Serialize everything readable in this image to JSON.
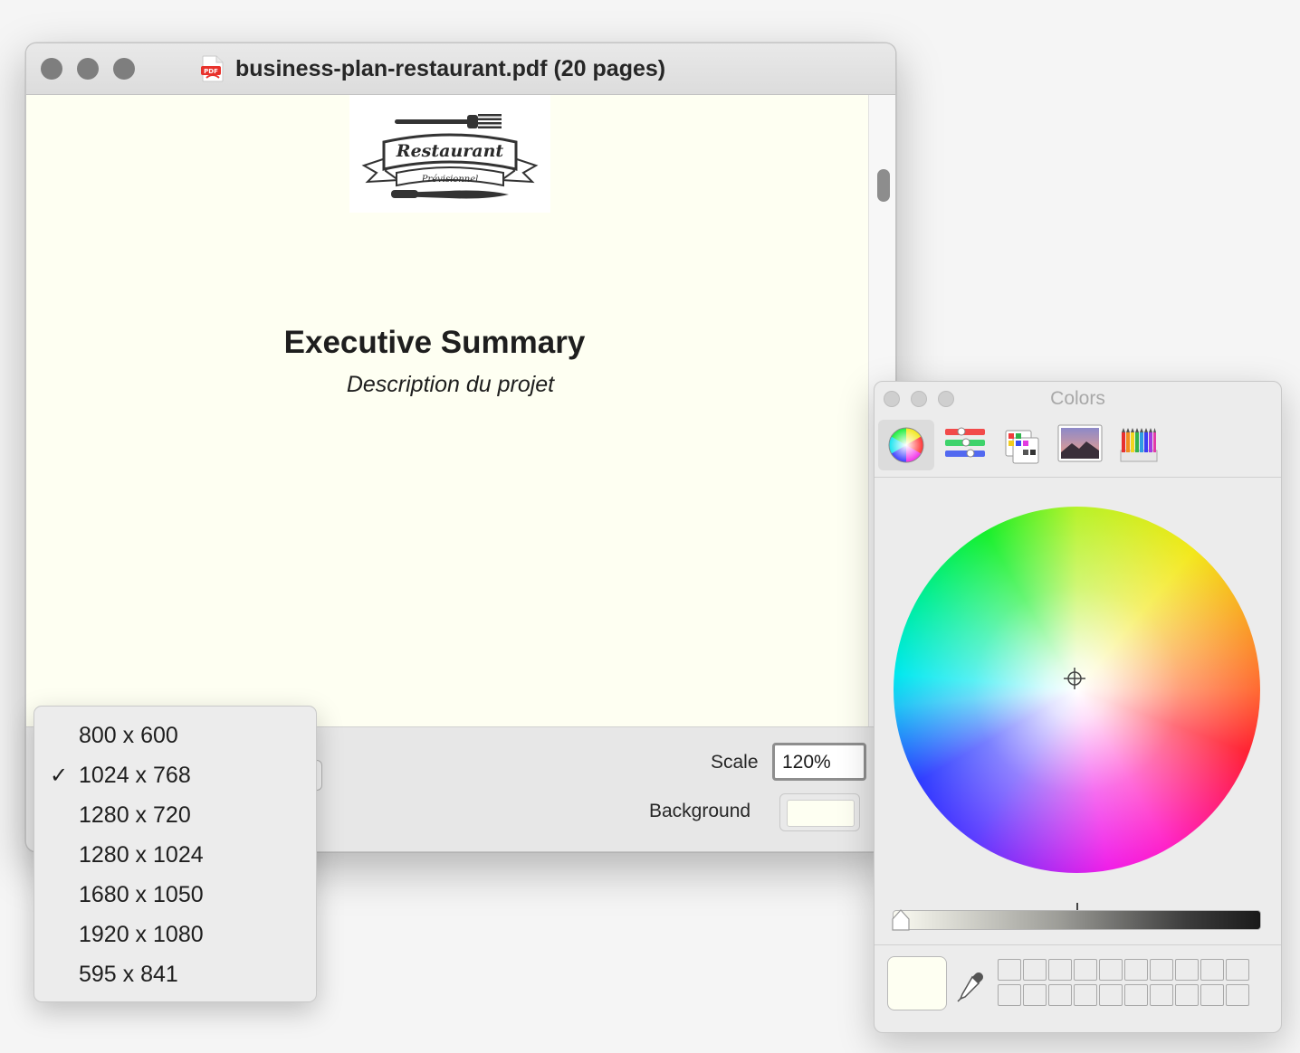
{
  "window": {
    "title": "business-plan-restaurant.pdf (20 pages)"
  },
  "document": {
    "logo_title": "Restaurant",
    "logo_subtitle": "Prévisionnel",
    "heading": "Executive Summary",
    "subheading": "Description du projet"
  },
  "controls": {
    "scale_label": "Scale",
    "scale_value": "120%",
    "background_label": "Background",
    "background_color": "#fefff2"
  },
  "size_menu": {
    "items": [
      {
        "label": "800 x 600",
        "checked": false
      },
      {
        "label": "1024 x 768",
        "checked": true
      },
      {
        "label": "1280 x 720",
        "checked": false
      },
      {
        "label": "1280 x 1024",
        "checked": false
      },
      {
        "label": "1680 x 1050",
        "checked": false
      },
      {
        "label": "1920 x 1080",
        "checked": false
      },
      {
        "label": "595 x 841",
        "checked": false
      }
    ],
    "check_glyph": "✓"
  },
  "colors_panel": {
    "title": "Colors",
    "modes": [
      {
        "icon": "color-wheel-icon",
        "active": true
      },
      {
        "icon": "color-sliders-icon",
        "active": false
      },
      {
        "icon": "color-palettes-icon",
        "active": false
      },
      {
        "icon": "image-palettes-icon",
        "active": false
      },
      {
        "icon": "pencils-icon",
        "active": false
      }
    ],
    "current_color": "#fefff2",
    "swatch_count": 20
  }
}
